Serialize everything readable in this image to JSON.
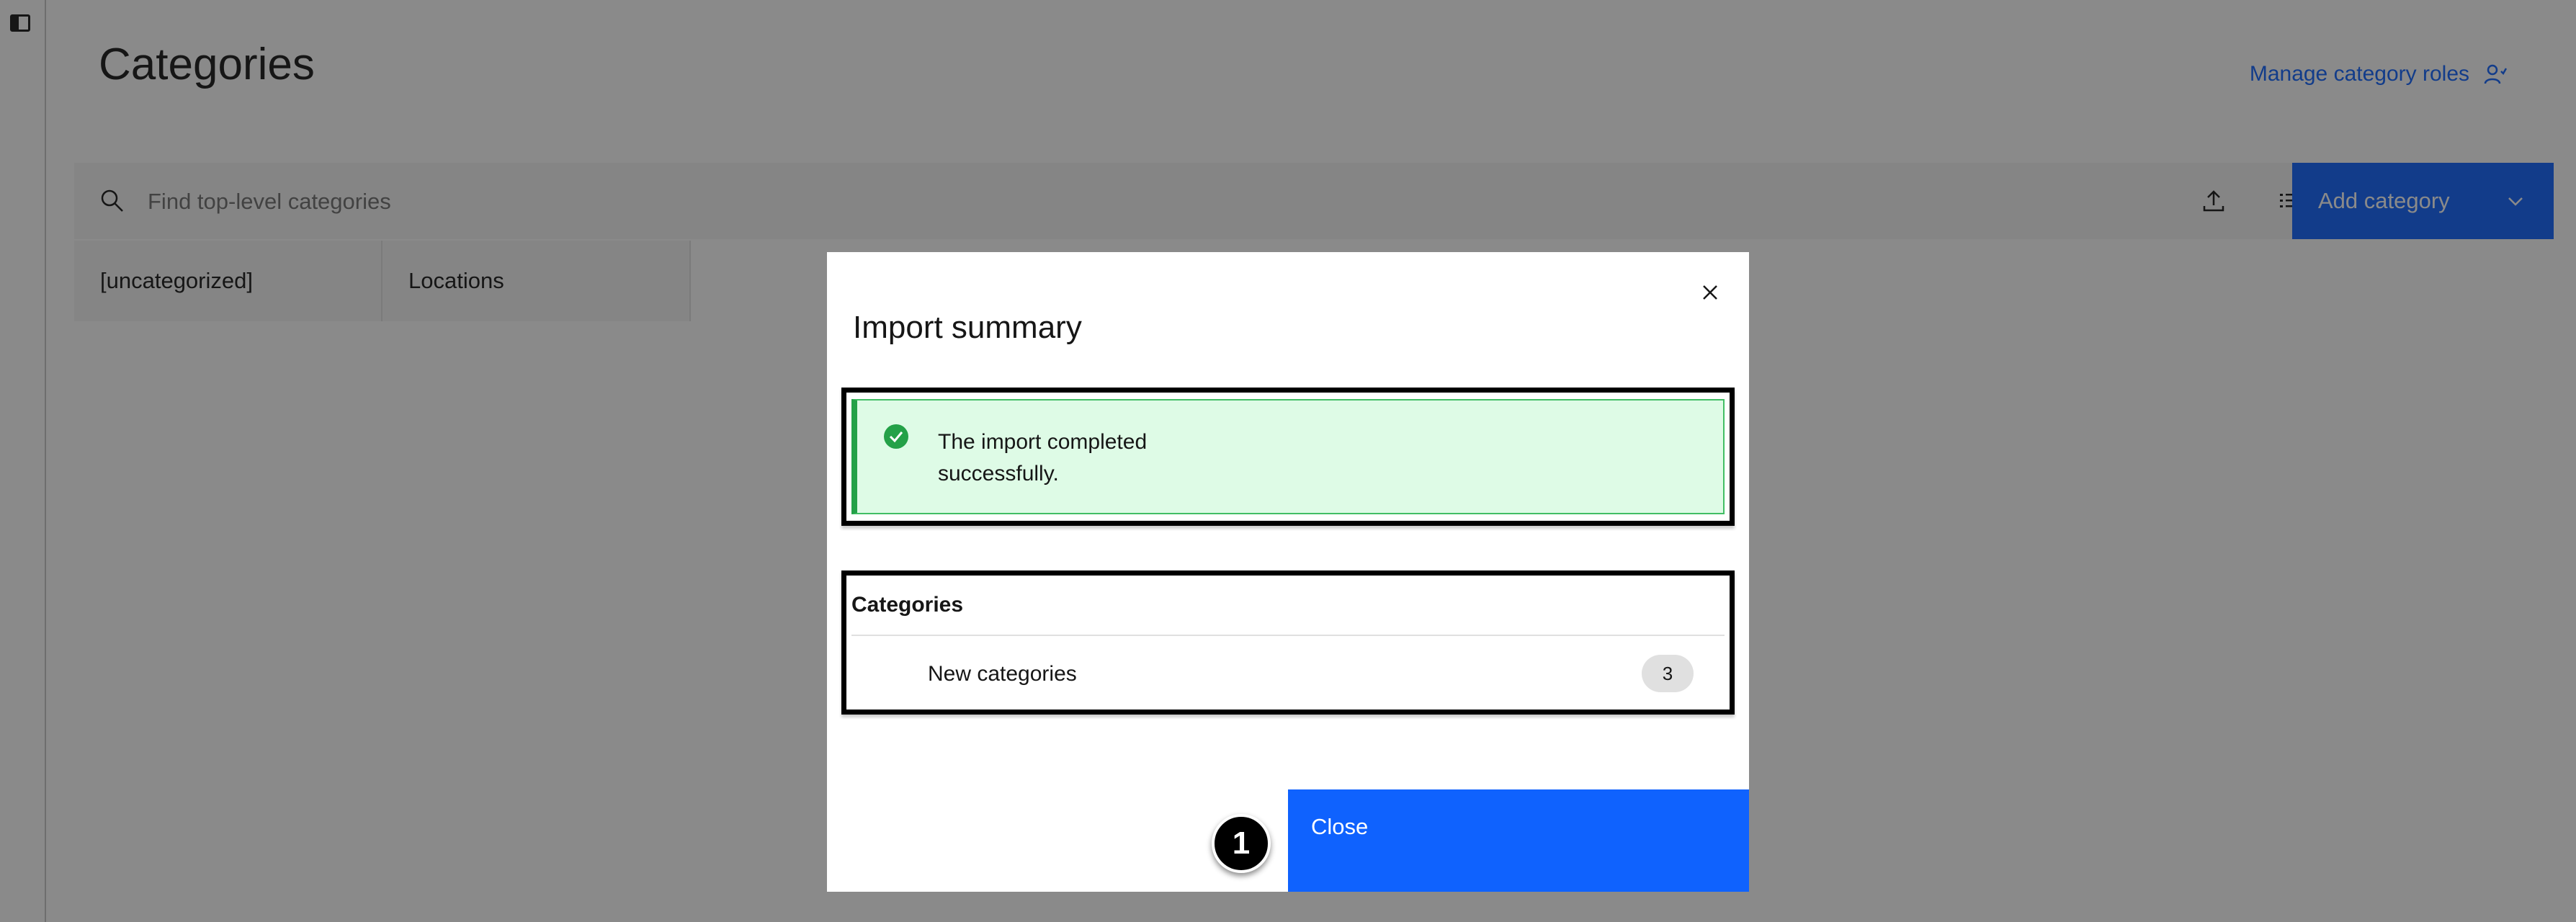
{
  "page": {
    "title": "Categories",
    "manage_link": "Manage category roles"
  },
  "toolbar": {
    "search_placeholder": "Find top-level categories",
    "add_label": "Add category"
  },
  "tiles": [
    "[uncategorized]",
    "Locations"
  ],
  "modal": {
    "title": "Import summary",
    "notification": "The import completed successfully.",
    "section_title": "Categories",
    "row_label": "New categories",
    "row_count": "3",
    "close_label": "Close"
  },
  "step_marker": "1",
  "colors": {
    "primary": "#0f62fe",
    "success": "#24a148",
    "success_bg": "#defbe6"
  },
  "icons": [
    "side-panel-icon",
    "user-role-icon",
    "search-icon",
    "upload-icon",
    "list-icon",
    "chevron-down-icon",
    "close-icon",
    "checkmark-filled-icon"
  ]
}
